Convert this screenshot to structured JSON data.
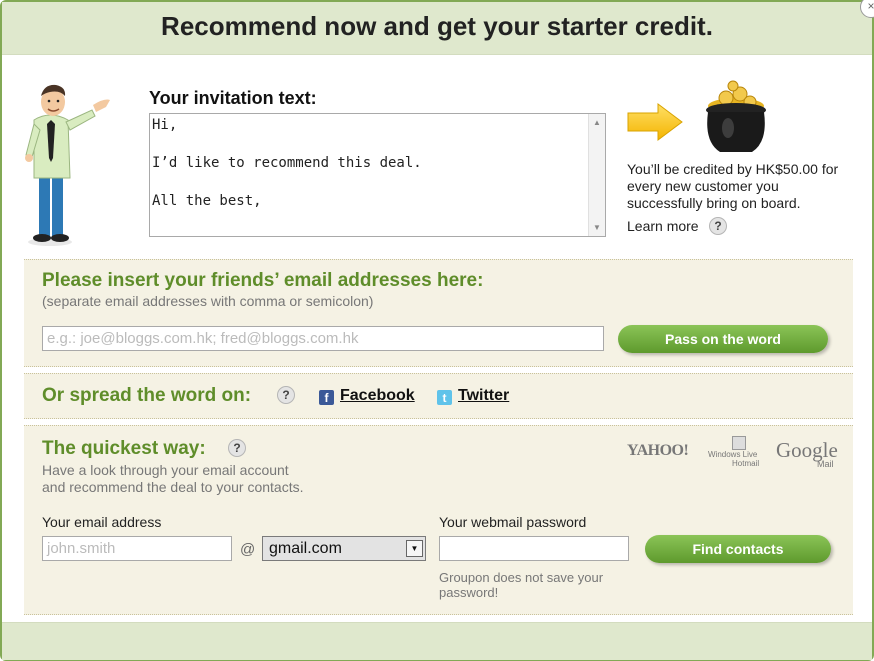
{
  "dialog": {
    "title": "Recommend now and get your starter credit.",
    "close_glyph": "×"
  },
  "invitation": {
    "label": "Your invitation text:",
    "lines": [
      "Hi,",
      "",
      "I’d like to recommend this deal.",
      "",
      "All the best,"
    ]
  },
  "credit": {
    "text": "You’ll be credited by HK$50.00 for every new customer you successfully bring on board.",
    "learn_more": "Learn more",
    "help_glyph": "?"
  },
  "friends": {
    "title": "Please insert your friends’ email addresses here:",
    "subtitle": "(separate email addresses with comma or semicolon)",
    "placeholder": "e.g.: joe@bloggs.com.hk; fred@bloggs.com.hk",
    "button": "Pass on the word"
  },
  "spread": {
    "title": "Or spread the word on:",
    "help_glyph": "?",
    "facebook": "Facebook",
    "twitter": "Twitter",
    "facebook_glyph": "f",
    "twitter_glyph": "t"
  },
  "quickest": {
    "title": "The quickest way:",
    "help_glyph": "?",
    "description_line1": "Have a look through your email account",
    "description_line2": "and recommend the deal to your contacts.",
    "logos": {
      "yahoo": "YAHOO!",
      "windows_live_1": "Windows Live",
      "windows_live_2": "Hotmail",
      "google": "Google",
      "google_sub": "Mail"
    },
    "email_label": "Your email address",
    "email_placeholder": "john.smith",
    "at": "@",
    "domain": "gmail.com",
    "password_label": "Your webmail password",
    "note": "Groupon does not save your password!",
    "button": "Find contacts"
  },
  "colors": {
    "accent_green": "#5f8d2a",
    "header_band": "#dfe8cd",
    "section_bg": "#f5f2e4"
  }
}
